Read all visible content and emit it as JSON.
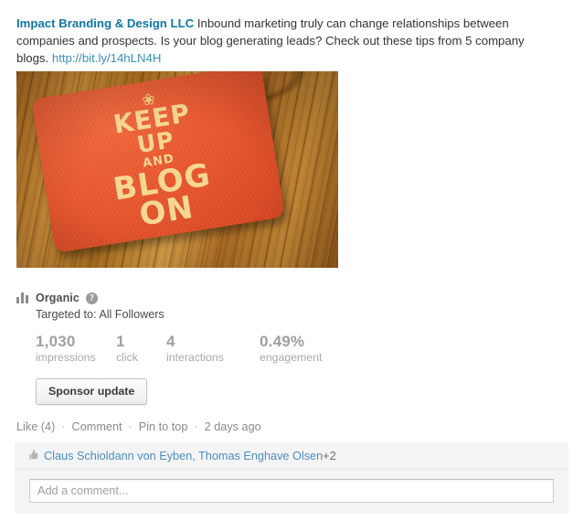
{
  "post": {
    "company_name": "Impact Branding & Design LLC",
    "body_text": " Inbound marketing truly can change relationships between companies and prospects. Is your blog generating leads? Check out these tips from 5 company blogs. ",
    "link_text": "http://bit.ly/14hLN4H",
    "photo": {
      "alt": "Orange coaster on wooden table",
      "crown_glyph": "❀",
      "line1": "KEEP",
      "line2": "UP",
      "line3": "AND",
      "line4": "BLOG",
      "line5": "ON",
      "coaster_color": "#e8532a",
      "text_color": "#f6d792",
      "wood_color": "#b5762a"
    }
  },
  "stats": {
    "icon": "bar-chart-icon",
    "type_label": "Organic",
    "help_glyph": "?",
    "targeting": "Targeted to: All Followers",
    "metrics": [
      {
        "value": "1,030",
        "label": "impressions"
      },
      {
        "value": "1",
        "label": "click"
      },
      {
        "value": "4",
        "label": "interactions"
      },
      {
        "value": "0.49%",
        "label": "engagement"
      }
    ]
  },
  "actions": {
    "sponsor_label": "Sponsor update"
  },
  "social": {
    "like_label": "Like (4)",
    "comment_label": "Comment",
    "pin_label": "Pin to top",
    "timestamp": "2 days ago",
    "separator": "·"
  },
  "likers": {
    "icon": "thumbs-up-icon",
    "thumb_glyph": "👍",
    "names": "Claus Schioldann von Eyben, Thomas Enghave Olsen",
    "more_count": "+2"
  },
  "comment_box": {
    "placeholder": "Add a comment...",
    "value": ""
  },
  "colors": {
    "link_blue": "#0e76a8",
    "url_blue": "#3a8fbf",
    "muted_gray": "#a8a8a8",
    "panel_gray": "#f4f4f4"
  }
}
